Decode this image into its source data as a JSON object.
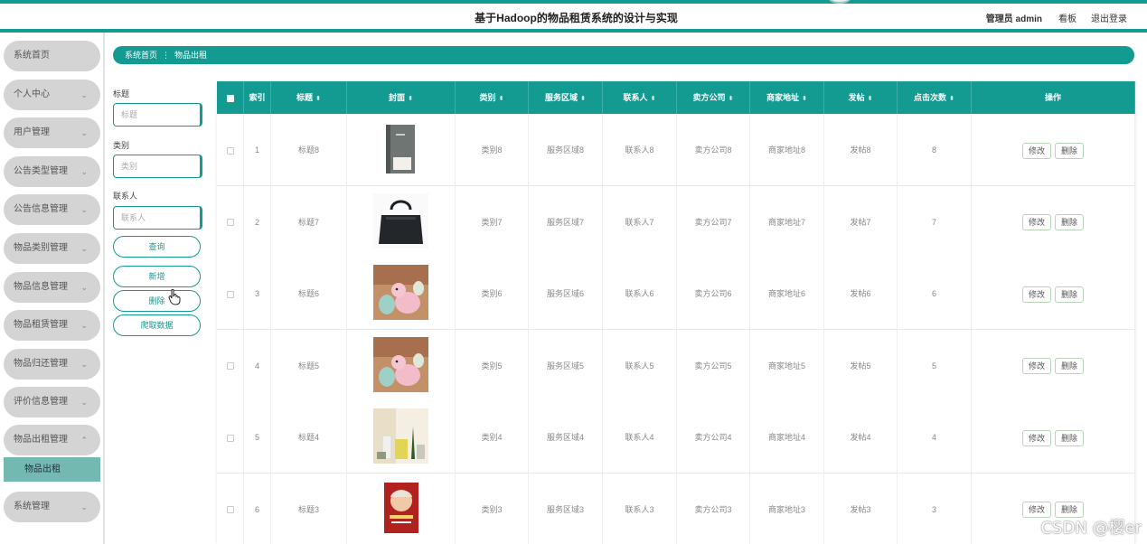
{
  "header": {
    "title": "基于Hadoop的物品租赁系统的设计与实现",
    "user": "管理员 admin",
    "board": "看板",
    "logout": "退出登录"
  },
  "sidebar": {
    "items": [
      {
        "label": "系统首页",
        "chevron": ""
      },
      {
        "label": "个人中心",
        "chevron": "⌄"
      },
      {
        "label": "用户管理",
        "chevron": "⌄"
      },
      {
        "label": "公告类型管理",
        "chevron": "⌄"
      },
      {
        "label": "公告信息管理",
        "chevron": "⌄"
      },
      {
        "label": "物品类别管理",
        "chevron": "⌄"
      },
      {
        "label": "物品信息管理",
        "chevron": "⌄"
      },
      {
        "label": "物品租赁管理",
        "chevron": "⌄"
      },
      {
        "label": "物品归还管理",
        "chevron": "⌄"
      },
      {
        "label": "评价信息管理",
        "chevron": "⌄"
      },
      {
        "label": "物品出租管理",
        "chevron": "⌃"
      },
      {
        "label": "系统管理",
        "chevron": "⌄"
      }
    ],
    "submenu": "物品出租"
  },
  "breadcrumb": {
    "home": "系统首页",
    "separator": "⋮",
    "current": "物品出租"
  },
  "search": {
    "title_label": "标题",
    "title_placeholder": "标题",
    "category_label": "类别",
    "category_placeholder": "类别",
    "contact_label": "联系人",
    "contact_placeholder": "联系人",
    "query": "查询",
    "add": "新增",
    "delete": "删除",
    "crawl": "爬取数据"
  },
  "table": {
    "headers": [
      "索引",
      "标题",
      "封面",
      "类别",
      "服务区域",
      "联系人",
      "卖方公司",
      "商家地址",
      "发帖",
      "点击次数",
      "操作"
    ],
    "sortable": [
      false,
      true,
      true,
      true,
      true,
      true,
      true,
      true,
      true,
      true,
      false
    ],
    "edit": "修改",
    "remove": "删除",
    "rows": [
      {
        "index": "1",
        "title": "标题8",
        "cover": "book-cover-image",
        "category": "类别8",
        "area": "服务区域8",
        "contact": "联系人8",
        "company": "卖方公司8",
        "address": "商家地址8",
        "post": "发帖8",
        "clicks": "8"
      },
      {
        "index": "2",
        "title": "标题7",
        "cover": "handbag-image",
        "category": "类别7",
        "area": "服务区域7",
        "contact": "联系人7",
        "company": "卖方公司7",
        "address": "商家地址7",
        "post": "发帖7",
        "clicks": "7"
      },
      {
        "index": "3",
        "title": "标题6",
        "cover": "alpaca-toys-image",
        "category": "类别6",
        "area": "服务区域6",
        "contact": "联系人6",
        "company": "卖方公司6",
        "address": "商家地址6",
        "post": "发帖6",
        "clicks": "6"
      },
      {
        "index": "4",
        "title": "标题5",
        "cover": "alpaca-toys-image",
        "category": "类别5",
        "area": "服务区域5",
        "contact": "联系人5",
        "company": "卖方公司5",
        "address": "商家地址5",
        "post": "发帖5",
        "clicks": "5"
      },
      {
        "index": "5",
        "title": "标题4",
        "cover": "cosmetics-image",
        "category": "类别4",
        "area": "服务区域4",
        "contact": "联系人4",
        "company": "卖方公司4",
        "address": "商家地址4",
        "post": "发帖4",
        "clicks": "4"
      },
      {
        "index": "6",
        "title": "标题3",
        "cover": "red-book-image",
        "category": "类别3",
        "area": "服务区域3",
        "contact": "联系人3",
        "company": "卖方公司3",
        "address": "商家地址3",
        "post": "发帖3",
        "clicks": "3"
      }
    ]
  },
  "watermark": "CSDN @樱er",
  "colors": {
    "accent": "#139a91",
    "menu": "#d4d4d4",
    "submenu": "#74b8b2"
  }
}
